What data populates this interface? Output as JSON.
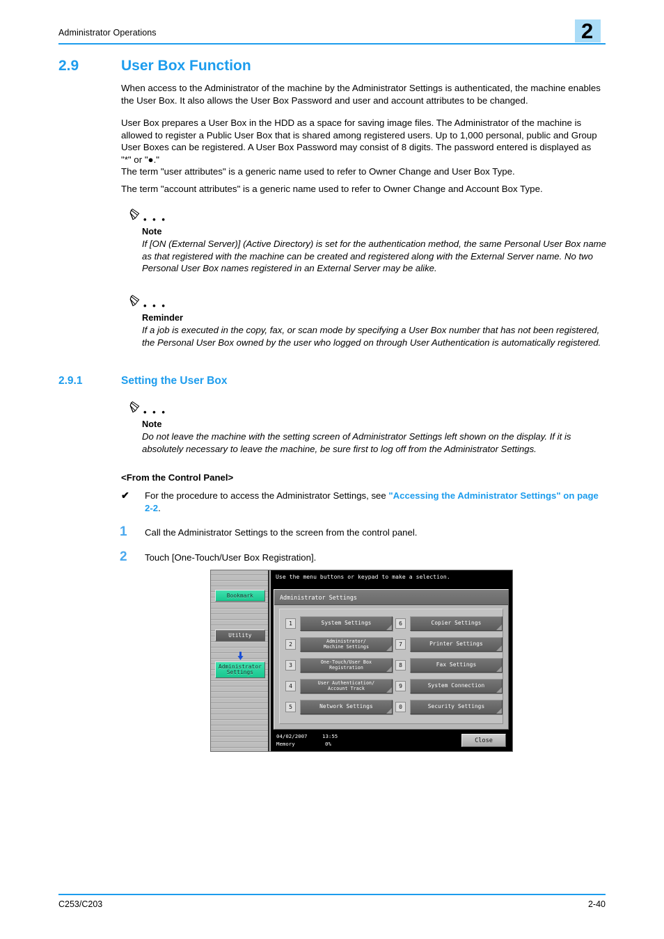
{
  "header": {
    "running_title": "Administrator Operations",
    "chapter_number": "2"
  },
  "section": {
    "number": "2.9",
    "title": "User Box Function"
  },
  "paragraphs": [
    "When access to the Administrator of the machine by the Administrator Settings is authenticated, the machine enables the User Box. It also allows the User Box Password and user and account attributes to be changed.",
    "User Box prepares a User Box in the HDD as a space for saving image files. The Administrator of the machine is allowed to register a Public User Box that is shared among registered users. Up to 1,000 personal, public and Group User Boxes can be registered. A User Box Password may consist of 8 digits. The password entered is displayed as \"*\" or \"●.\"",
    "The term \"user attributes\" is a generic name used to refer to Owner Change and User Box Type.",
    "The term \"account attributes\" is a generic name used to refer to Owner Change and Account Box Type."
  ],
  "notes": [
    {
      "dots": "• • •",
      "label": "Note",
      "body": "If [ON (External Server)] (Active Directory) is set for the authentication method, the same Personal User Box name as that registered with the machine can be created and registered along with the External Server name. No two Personal User Box names registered in an External Server may be alike."
    },
    {
      "dots": "• • •",
      "label": "Reminder",
      "body": "If a job is executed in the copy, fax, or scan mode by specifying a User Box number that has not been registered, the Personal User Box owned by the user who logged on through User Authentication is automatically registered."
    },
    {
      "dots": "• • •",
      "label": "Note",
      "body": "Do not leave the machine with the setting screen of Administrator Settings left shown on the display. If it is absolutely necessary to leave the machine, be sure first to log off from the Administrator Settings."
    }
  ],
  "subsection": {
    "number": "2.9.1",
    "title": "Setting the User Box"
  },
  "procedure": {
    "heading": "<From the Control Panel>",
    "check_mark": "✔",
    "check_text_before": "For the procedure to access the Administrator Settings, see ",
    "check_link": "\"Accessing the Administrator Settings\" on page 2-2",
    "check_text_after": ".",
    "steps": [
      {
        "number": "1",
        "text": "Call the Administrator Settings to the screen from the control panel."
      },
      {
        "number": "2",
        "text": "Touch [One-Touch/User Box Registration]."
      }
    ]
  },
  "control_panel": {
    "message": "Use the menu buttons or keypad to make a selection.",
    "card_title": "Administrator Settings",
    "side_buttons": [
      {
        "label": "Bookmark",
        "style": "green"
      },
      {
        "label": "Utility",
        "style": "grey"
      },
      {
        "label": "Administrator\nSettings",
        "style": "green"
      }
    ],
    "arrow_icon": "↓",
    "menu_left": [
      {
        "key": "1",
        "label": "System Settings"
      },
      {
        "key": "2",
        "label": "Administrator/\nMachine Settings"
      },
      {
        "key": "3",
        "label": "One-Touch/User Box\nRegistration"
      },
      {
        "key": "4",
        "label": "User Authentication/\nAccount Track"
      },
      {
        "key": "5",
        "label": "Network Settings"
      }
    ],
    "menu_right": [
      {
        "key": "6",
        "label": "Copier Settings"
      },
      {
        "key": "7",
        "label": "Printer Settings"
      },
      {
        "key": "8",
        "label": "Fax Settings"
      },
      {
        "key": "9",
        "label": "System Connection"
      },
      {
        "key": "0",
        "label": "Security Settings"
      }
    ],
    "status": {
      "date": "04/02/2007",
      "time": "13:55",
      "memory_label": "Memory",
      "memory_value": "0%"
    },
    "close_label": "Close"
  },
  "footer": {
    "left": "C253/C203",
    "right": "2-40"
  },
  "colors": {
    "accent_blue": "#1c9ced",
    "badge_blue": "#aadcf7",
    "panel_green": "#19c78f"
  }
}
